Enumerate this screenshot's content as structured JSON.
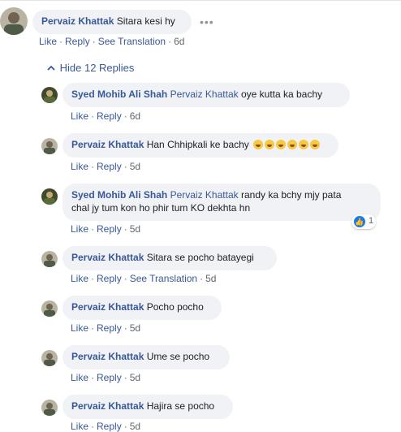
{
  "main_comment": {
    "author": "Pervaiz Khattak",
    "text": "Sitara kesi hy",
    "actions": {
      "like": "Like",
      "reply": "Reply",
      "translate": "See Translation",
      "time": "6d"
    },
    "more_icon": "more-horizontal-icon"
  },
  "replies_toggle": {
    "label": "Hide 12 Replies",
    "icon": "chevron-up-icon"
  },
  "replies": [
    {
      "author": "Syed Mohib Ali Shah",
      "mention": "Pervaiz Khattak",
      "text": "oye kutta ka bachy",
      "like": "Like",
      "reply": "Reply",
      "time": "6d"
    },
    {
      "author": "Pervaiz Khattak",
      "text": "Han Chhipkali ke bachy",
      "emoji_icon": "rofl-emoji-icon",
      "emoji_count": 6,
      "like": "Like",
      "reply": "Reply",
      "time": "5d"
    },
    {
      "author": "Syed Mohib Ali Shah",
      "mention": "Pervaiz Khattak",
      "text1": "randy ka bchy mjy pata",
      "text2": "chal jy tum kon ho phir tum KO dekhta hn",
      "like": "Like",
      "reply": "Reply",
      "time": "5d",
      "reaction": {
        "icon": "like-reaction-icon",
        "count": "1"
      }
    },
    {
      "author": "Pervaiz Khattak",
      "text": "Sitara se pocho batayegi",
      "like": "Like",
      "reply": "Reply",
      "translate": "See Translation",
      "time": "5d"
    },
    {
      "author": "Pervaiz Khattak",
      "text": "Pocho pocho",
      "like": "Like",
      "reply": "Reply",
      "time": "5d"
    },
    {
      "author": "Pervaiz Khattak",
      "text": "Ume se pocho",
      "like": "Like",
      "reply": "Reply",
      "time": "5d"
    },
    {
      "author": "Pervaiz Khattak",
      "text": "Hajira se pocho",
      "like": "Like",
      "reply": "Reply",
      "time": "5d"
    }
  ],
  "colors": {
    "link": "#385898",
    "bubble": "#f0f2f5",
    "meta": "#606770",
    "like_blue": "#1877f2"
  }
}
